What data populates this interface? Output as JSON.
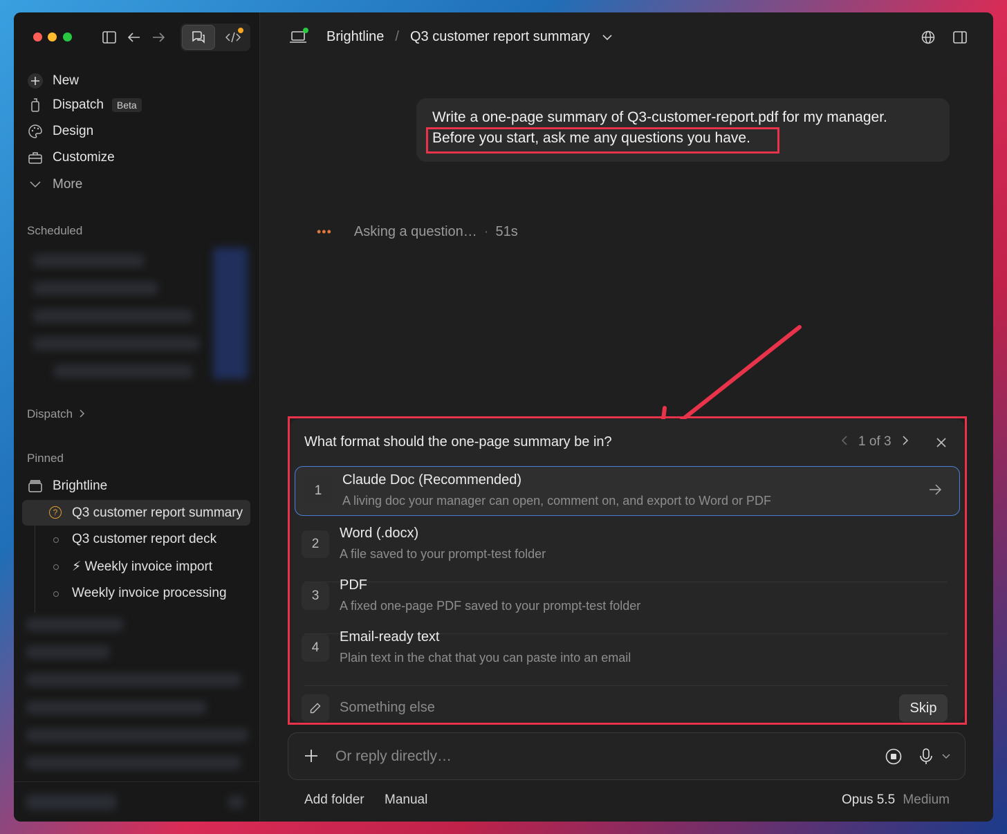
{
  "topbar": {
    "project": "Brightline",
    "separator": "/",
    "conversation": "Q3 customer report summary"
  },
  "sidebar": {
    "new_label": "New",
    "dispatch_label": "Dispatch",
    "dispatch_badge": "Beta",
    "design_label": "Design",
    "customize_label": "Customize",
    "more_label": "More",
    "scheduled_header": "Scheduled",
    "dispatch_header": "Dispatch",
    "pinned_header": "Pinned",
    "project_label": "Brightline",
    "items": [
      {
        "label": "Q3 customer report summary",
        "icon": "question-circle-icon"
      },
      {
        "label": "Q3 customer report deck",
        "icon": "dot-icon"
      },
      {
        "label": "⚡ Weekly invoice import",
        "icon": "dot-icon"
      },
      {
        "label": "Weekly invoice processing",
        "icon": "dot-icon"
      }
    ]
  },
  "chat": {
    "user_message_line1": "Write a one-page summary of Q3-customer-report.pdf for my manager.",
    "user_message_line2": "Before you start, ask me any questions you have.",
    "status_text": "Asking a question…",
    "status_sep": "·",
    "status_time": "51s"
  },
  "question": {
    "prompt": "What format should the one-page summary be in?",
    "pager": "1 of 3",
    "options": [
      {
        "num": "1",
        "title": "Claude Doc (Recommended)",
        "desc": "A living doc your manager can open, comment on, and export to Word or PDF"
      },
      {
        "num": "2",
        "title": "Word (.docx)",
        "desc": "A file saved to your prompt-test folder"
      },
      {
        "num": "3",
        "title": "PDF",
        "desc": "A fixed one-page PDF saved to your prompt-test folder"
      },
      {
        "num": "4",
        "title": "Email-ready text",
        "desc": "Plain text in the chat that you can paste into an email"
      }
    ],
    "something_else": "Something else",
    "skip_label": "Skip"
  },
  "composer": {
    "placeholder": "Or reply directly…",
    "add_folder": "Add folder",
    "mode": "Manual",
    "model": "Opus 5.5",
    "effort": "Medium"
  },
  "colors": {
    "annotation_red": "#e8334a",
    "accent_blue": "#4a7fd6",
    "traffic_red": "#ff5f57",
    "traffic_yellow": "#febc2e",
    "traffic_green": "#28c840",
    "status_orange": "#e0a030"
  }
}
